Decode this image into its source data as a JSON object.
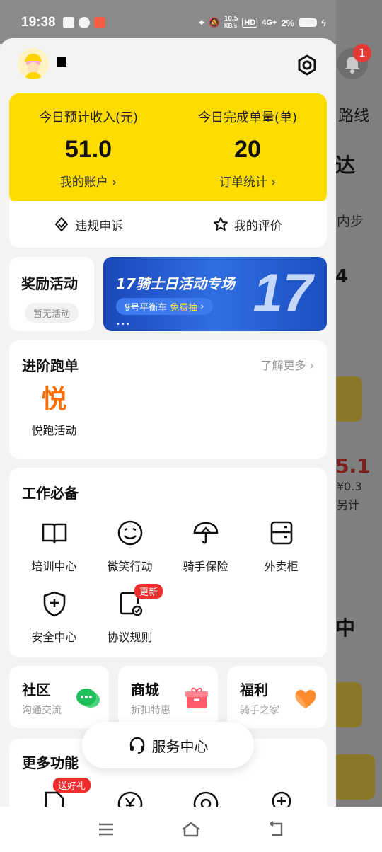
{
  "status_bar": {
    "time": "19:38",
    "net_speed_value": "10.5",
    "net_speed_unit": "KB/s",
    "hd": "HD",
    "network": "4G+",
    "battery": "2%"
  },
  "background_app": {
    "bell_badge": "1",
    "text_route": "路线",
    "text_arrive": "达",
    "text_step": "内步",
    "text_4": "4",
    "text_amount": "5.1",
    "text_small": "¥0.3",
    "text_total": "另计",
    "text_mid": "中"
  },
  "header": {
    "username": "■",
    "settings_icon": "hexagon-gear-icon"
  },
  "income": {
    "left_label": "今日预计收入(元)",
    "left_value": "51.0",
    "left_link": "我的账户 ›",
    "right_label": "今日完成单量(单)",
    "right_value": "20",
    "right_link": "订单统计 ›"
  },
  "sub_actions": {
    "complaint": "违规申诉",
    "rating": "我的评价"
  },
  "reward": {
    "title": "奖励活动",
    "tag": "暂无活动"
  },
  "banner": {
    "title": "17骑士日活动专场",
    "pill_prefix": "9号平衡车",
    "pill_highlight": "免费抽",
    "pill_arrow": "›",
    "dots": "•••",
    "big_number": "17"
  },
  "advanced": {
    "title": "进阶跑单",
    "more": "了解更多 ›",
    "item_char": "悦",
    "item_label": "悦跑活动"
  },
  "work": {
    "title": "工作必备",
    "items": [
      {
        "label": "培训中心",
        "icon": "book-icon"
      },
      {
        "label": "微笑行动",
        "icon": "smile-icon"
      },
      {
        "label": "骑手保险",
        "icon": "umbrella-icon"
      },
      {
        "label": "外卖柜",
        "icon": "locker-icon"
      },
      {
        "label": "安全中心",
        "icon": "shield-plus-icon"
      },
      {
        "label": "协议规则",
        "icon": "document-check-icon"
      }
    ],
    "new_badge": "更新"
  },
  "mini_cards": [
    {
      "title": "社区",
      "sub": "沟通交流",
      "icon": "chat-bubble-icon",
      "color": "#2bc46c"
    },
    {
      "title": "商城",
      "sub": "折扣特惠",
      "icon": "gift-box-icon",
      "color": "#ff5a6a"
    },
    {
      "title": "福利",
      "sub": "骑手之家",
      "icon": "heart-icon",
      "color": "#ff8a2c"
    }
  ],
  "service": {
    "label": "服务中心"
  },
  "more": {
    "title": "更多功能",
    "gift_badge": "送好礼"
  },
  "colors": {
    "brand_yellow": "#ffdc00",
    "badge_red": "#f02d2d",
    "accent_orange": "#ff6d00"
  }
}
